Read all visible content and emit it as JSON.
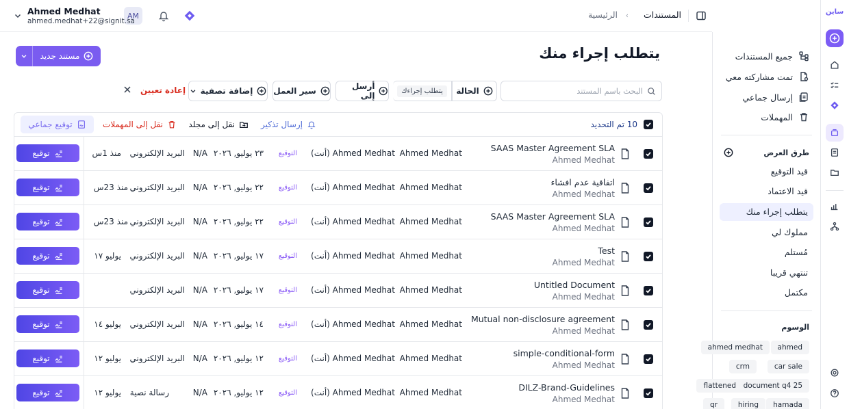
{
  "rail": {
    "logo": "ساين"
  },
  "header": {
    "breadcrumb_home": "الرئيسية",
    "breadcrumb_current": "المستندات",
    "user_name": "Ahmed Medhat",
    "user_email": "ahmed.medhat+22@signit.sa",
    "avatar_initials": "AM"
  },
  "sidebar": {
    "nav": [
      {
        "label": "جميع المستندات",
        "icon": "documents-tree-icon"
      },
      {
        "label": "تمت مشاركته معي",
        "icon": "shared-doc-icon"
      },
      {
        "label": "إرسال جماعي",
        "icon": "bulk-send-icon"
      },
      {
        "label": "المهملات",
        "icon": "trash-icon"
      }
    ],
    "views_title": "طرق العرض",
    "views": [
      {
        "label": "قيد التوقيع",
        "active": false
      },
      {
        "label": "قيد الاعتماد",
        "active": false
      },
      {
        "label": "يتطلب إجراء منك",
        "active": true
      },
      {
        "label": "مملوك لي",
        "active": false
      },
      {
        "label": "مُستلم",
        "active": false
      },
      {
        "label": "تنتهي قريبا",
        "active": false
      },
      {
        "label": "مكتمل",
        "active": false
      }
    ],
    "tags_title": "الوسوم",
    "tags": [
      "ahmed",
      "ahmed medhat",
      "car sale",
      "crm",
      "document q4 25",
      "flattened",
      "hamada",
      "hiring",
      "qr"
    ]
  },
  "page": {
    "title": "يتطلب إجراء منك",
    "new_document": "مستند جديد"
  },
  "filters": {
    "search_placeholder": "البحث باسم المستند",
    "status": "الحالة",
    "status_value": "يتطلب إجراءك",
    "send_to": "أرسل إلى",
    "workflow": "سير العمل",
    "add_filter": "إضافة تصفية",
    "reset": "إعادة تعيين"
  },
  "bulk": {
    "count": "10 تم التحديد",
    "remind": "إرسال تذكير",
    "move_folder": "نقل إلى مجلد",
    "move_trash": "نقل إلى المهملات",
    "bulk_sign": "توقيع جماعي"
  },
  "rows": [
    {
      "name": "SAAS Master Agreement SLA",
      "owner": "Ahmed Medhat",
      "sender": "Ahmed Medhat",
      "recipient": "Ahmed Medhat (أنت)",
      "status": "التوقيع",
      "date": "٢٣ يوليو, ٢٠٢٦",
      "na": "N/A",
      "channel": "البريد الإلكتروني",
      "since": "منذ 1س",
      "action": "توقيع"
    },
    {
      "name": "اتفاقية عدم افشاء",
      "owner": "Ahmed Medhat",
      "sender": "Ahmed Medhat",
      "recipient": "Ahmed Medhat (أنت)",
      "status": "التوقيع",
      "date": "٢٢ يوليو, ٢٠٢٦",
      "na": "N/A",
      "channel": "البريد الإلكتروني",
      "since": "منذ 23س",
      "action": "توقيع"
    },
    {
      "name": "SAAS Master Agreement SLA",
      "owner": "Ahmed Medhat",
      "sender": "Ahmed Medhat",
      "recipient": "Ahmed Medhat (أنت)",
      "status": "التوقيع",
      "date": "٢٢ يوليو, ٢٠٢٦",
      "na": "N/A",
      "channel": "البريد الإلكتروني",
      "since": "منذ 23س",
      "action": "توقيع"
    },
    {
      "name": "Test",
      "owner": "Ahmed Medhat",
      "sender": "Ahmed Medhat",
      "recipient": "Ahmed Medhat (أنت)",
      "status": "التوقيع",
      "date": "١٧ يوليو, ٢٠٢٦",
      "na": "N/A",
      "channel": "البريد الإلكتروني",
      "since": "يوليو ١٧",
      "action": "توقيع"
    },
    {
      "name": "Untitled Document",
      "owner": "Ahmed Medhat",
      "sender": "Ahmed Medhat",
      "recipient": "Ahmed Medhat (أنت)",
      "status": "التوقيع",
      "date": "١٧ يوليو, ٢٠٢٦",
      "na": "N/A",
      "channel": "البريد الإلكتروني",
      "since": "",
      "action": "توقيع"
    },
    {
      "name": "Mutual non-disclosure agreement",
      "owner": "Ahmed Medhat",
      "sender": "Ahmed Medhat",
      "recipient": "Ahmed Medhat (أنت)",
      "status": "التوقيع",
      "date": "١٤ يوليو, ٢٠٢٦",
      "na": "N/A",
      "channel": "البريد الإلكتروني",
      "since": "يوليو ١٤",
      "action": "توقيع"
    },
    {
      "name": "simple-conditional-form",
      "owner": "Ahmed Medhat",
      "sender": "Ahmed Medhat",
      "recipient": "Ahmed Medhat (أنت)",
      "status": "التوقيع",
      "date": "١٢ يوليو, ٢٠٢٦",
      "na": "N/A",
      "channel": "البريد الإلكتروني",
      "since": "يوليو ١٢",
      "action": "توقيع"
    },
    {
      "name": "DILZ-Brand-Guidelines",
      "owner": "Ahmed Medhat",
      "sender": "Ahmed Medhat",
      "recipient": "Ahmed Medhat (أنت)",
      "status": "التوقيع",
      "date": "١٢ يوليو, ٢٠٢٦",
      "na": "N/A",
      "channel": "رسالة نصية",
      "since": "يوليو ١٢",
      "action": "توقيع"
    }
  ],
  "colors": {
    "primary": "#7a5cf0",
    "danger": "#d92d20",
    "active_view": "#eef0ff",
    "status_pill": "#8b5cf6"
  }
}
